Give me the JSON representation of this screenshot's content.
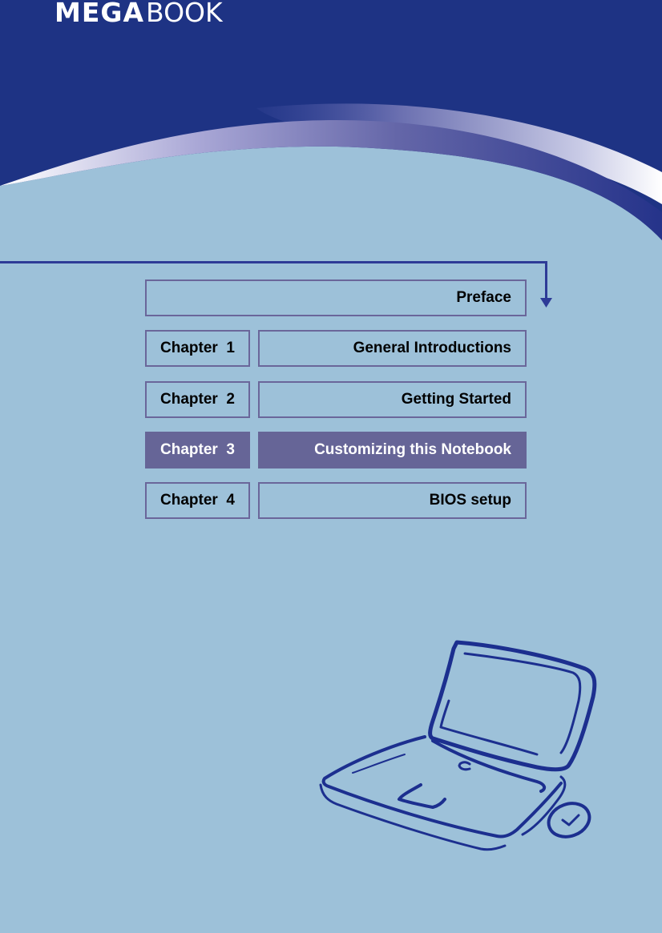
{
  "header": {
    "brand_part1": "MEGA",
    "brand_part2": "BOOK",
    "colors": {
      "header_bg": "#1e3384",
      "page_bg": "#9dc1d9",
      "accent": "#666597"
    }
  },
  "toc": {
    "preface": "Preface",
    "chapters": [
      {
        "number_label": "Chapter  1",
        "title": "General Introductions",
        "active": false
      },
      {
        "number_label": "Chapter  2",
        "title": "Getting Started",
        "active": false
      },
      {
        "number_label": "Chapter  3",
        "title": "Customizing this Notebook",
        "active": true
      },
      {
        "number_label": "Chapter  4",
        "title": "BIOS setup",
        "active": false
      }
    ]
  },
  "illustration": {
    "icon": "laptop-with-mouse-icon"
  }
}
